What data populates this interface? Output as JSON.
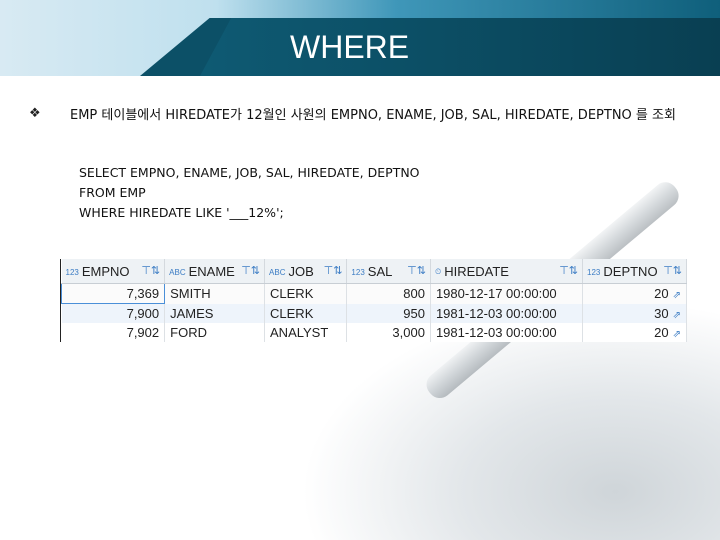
{
  "slide": {
    "title": "WHERE",
    "bullet_icon": "❖",
    "description": "EMP 테이블에서 HIREDATE가 12월인 사원의 EMPNO, ENAME, JOB, SAL, HIREDATE, DEPTNO 를 조회",
    "sql_lines": [
      "SELECT EMPNO, ENAME, JOB, SAL, HIREDATE, DEPTNO",
      "FROM EMP",
      "WHERE HIREDATE LIKE '___12%';"
    ]
  },
  "result_grid": {
    "columns": [
      {
        "type_badge": "123",
        "name": "EMPNO"
      },
      {
        "type_badge": "ABC",
        "name": "ENAME"
      },
      {
        "type_badge": "ABC",
        "name": "JOB"
      },
      {
        "type_badge": "123",
        "name": "SAL"
      },
      {
        "type_badge": "⏲",
        "name": "HIREDATE"
      },
      {
        "type_badge": "123",
        "name": "DEPTNO"
      }
    ],
    "rows": [
      [
        "7,369",
        "SMITH",
        "CLERK",
        "800",
        "1980-12-17 00:00:00",
        "20"
      ],
      [
        "7,900",
        "JAMES",
        "CLERK",
        "950",
        "1981-12-03 00:00:00",
        "30"
      ],
      [
        "7,902",
        "FORD",
        "ANALYST",
        "3,000",
        "1981-12-03 00:00:00",
        "20"
      ]
    ],
    "link_icon": "⇗",
    "filter_icon": "⊤⇅"
  }
}
